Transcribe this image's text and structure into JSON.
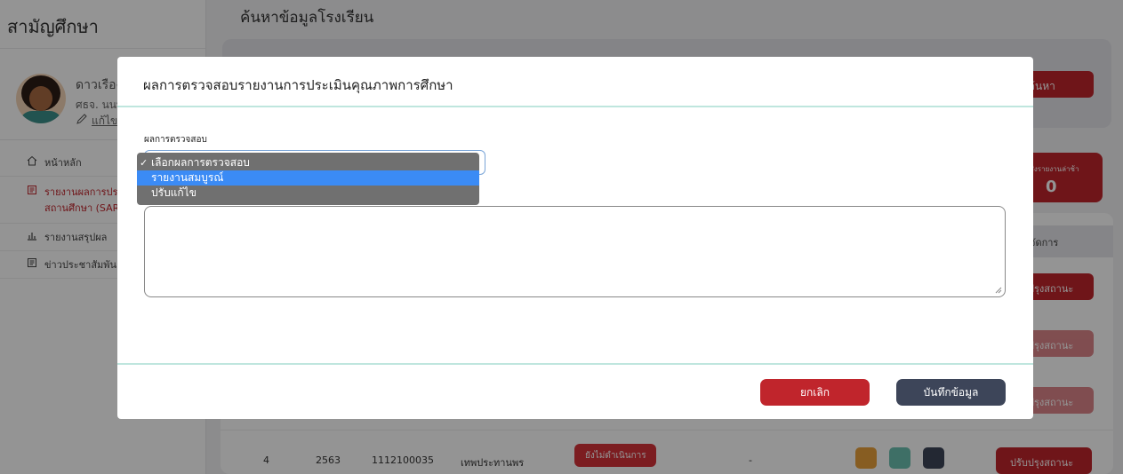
{
  "sidebar": {
    "brand": "สามัญศึกษา",
    "profile": {
      "name": "ดาวเรือง",
      "role": "ศธจ. นนท",
      "edit_label": "แก้ไข"
    },
    "items": [
      {
        "label": "หน้าหลัก",
        "icon": "home-icon"
      },
      {
        "label": "รายงานผลการประ สถานศึกษา (SAR)",
        "icon": "report-icon"
      },
      {
        "label": "รายงานสรุปผล",
        "icon": "chart-icon"
      },
      {
        "label": "ข่าวประชาสัมพันธ์",
        "icon": "news-icon"
      }
    ]
  },
  "main": {
    "title": "ค้นหาข้อมูลโรงเรียน",
    "search_button": "ค้นหา",
    "stat": {
      "label": "ส่งรายงานล่าช้า",
      "value": "0"
    },
    "table": {
      "manage_header": "จัดการ",
      "row_button": "ปรุงสถานะ",
      "last_row": {
        "no": "4",
        "year": "2563",
        "code": "1112100035",
        "name": "เทพประทานพร",
        "status": "ยังไม่ดำเนินการ",
        "dash": "-",
        "action_button": "ปรับปรุงสถานะ"
      }
    }
  },
  "modal": {
    "title": "ผลการตรวจสอบรายงานการประเมินคุณภาพการศึกษา",
    "field_label": "ผลการตรวจสอบ",
    "select_options": [
      {
        "label": "เลือกผลการตรวจสอบ",
        "checked": true
      },
      {
        "label": "รายงานสมบูรณ์",
        "highlighted": true
      },
      {
        "label": "ปรับแก้ไข"
      }
    ],
    "cancel_label": "ยกเลิก",
    "save_label": "บันทึกข้อมูล"
  },
  "colors": {
    "primary_red": "#c0252c",
    "dark_button": "#3d4559",
    "divider_teal": "#bfe6de",
    "highlight_blue": "#3b8bf5"
  }
}
